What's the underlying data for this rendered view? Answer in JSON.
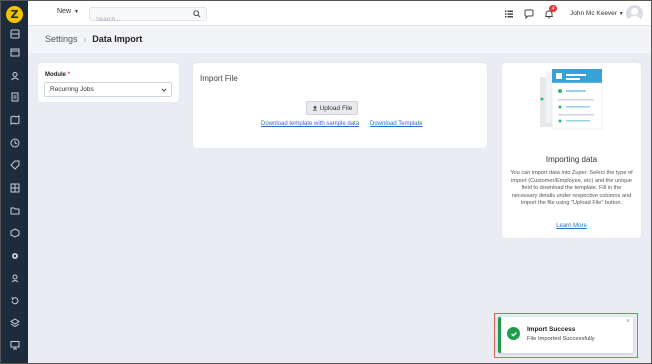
{
  "app": {
    "logo_letter": "Z"
  },
  "sidebar": {
    "items": [
      {
        "icon": "dashboard-icon"
      },
      {
        "icon": "calendar-icon"
      },
      {
        "icon": "users-icon"
      },
      {
        "icon": "document-icon"
      },
      {
        "icon": "map-icon"
      },
      {
        "icon": "clock-icon"
      },
      {
        "icon": "tag-icon"
      },
      {
        "icon": "grid-icon"
      },
      {
        "icon": "folder-icon"
      },
      {
        "icon": "box-icon"
      },
      {
        "icon": "settings-icon"
      },
      {
        "icon": "contacts-icon"
      },
      {
        "icon": "history-icon"
      },
      {
        "icon": "layers-icon"
      },
      {
        "icon": "monitor-icon"
      }
    ]
  },
  "topbar": {
    "new_label": "New",
    "search_placeholder": "Search..",
    "notification_count": "4",
    "user_name": "John Mc Keever"
  },
  "header": {
    "breadcrumb_parent": "Settings",
    "breadcrumb_current": "Data Import"
  },
  "module": {
    "label": "Module",
    "required_mark": "*",
    "selected": "Recurring Jobs"
  },
  "import_file": {
    "title": "Import File",
    "upload_label": "Upload File",
    "sample_link": "Download template with sample data",
    "template_link": "Download Template"
  },
  "info": {
    "title": "Importing data",
    "text": "You can import data into Zuper. Select the type of import (Customer/Employee, etc) and the unique field to download the template. Fill in the necessary details under respective columns and import the file using \"Upload File\" button.",
    "learn_more": "Learn More"
  },
  "toast": {
    "title": "Import Success",
    "message": "File Imported Successfully",
    "close": "×"
  },
  "colors": {
    "sidebar_bg": "#1d2b3d",
    "logo": "#f2c200",
    "link": "#2a6fc7",
    "success": "#1e9e4a",
    "badge": "#e53935"
  }
}
